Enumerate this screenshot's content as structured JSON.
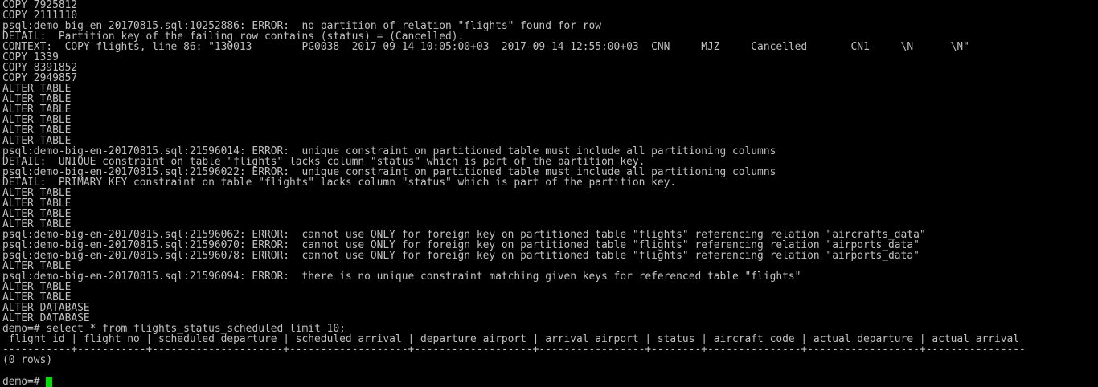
{
  "terminal": {
    "lines": [
      "COPY 7925812",
      "COPY 2111110",
      "psql:demo-big-en-20170815.sql:10252886: ERROR:  no partition of relation \"flights\" found for row",
      "DETAIL:  Partition key of the failing row contains (status) = (Cancelled).",
      "CONTEXT:  COPY flights, line 86: \"130013        PG0038  2017-09-14 10:05:00+03  2017-09-14 12:55:00+03  CNN     MJZ     Cancelled       CN1     \\N      \\N\"",
      "COPY 1339",
      "COPY 8391852",
      "COPY 2949857",
      "ALTER TABLE",
      "ALTER TABLE",
      "ALTER TABLE",
      "ALTER TABLE",
      "ALTER TABLE",
      "ALTER TABLE",
      "psql:demo-big-en-20170815.sql:21596014: ERROR:  unique constraint on partitioned table must include all partitioning columns",
      "DETAIL:  UNIQUE constraint on table \"flights\" lacks column \"status\" which is part of the partition key.",
      "psql:demo-big-en-20170815.sql:21596022: ERROR:  unique constraint on partitioned table must include all partitioning columns",
      "DETAIL:  PRIMARY KEY constraint on table \"flights\" lacks column \"status\" which is part of the partition key.",
      "ALTER TABLE",
      "ALTER TABLE",
      "ALTER TABLE",
      "ALTER TABLE",
      "psql:demo-big-en-20170815.sql:21596062: ERROR:  cannot use ONLY for foreign key on partitioned table \"flights\" referencing relation \"aircrafts_data\"",
      "psql:demo-big-en-20170815.sql:21596070: ERROR:  cannot use ONLY for foreign key on partitioned table \"flights\" referencing relation \"airports_data\"",
      "psql:demo-big-en-20170815.sql:21596078: ERROR:  cannot use ONLY for foreign key on partitioned table \"flights\" referencing relation \"airports_data\"",
      "ALTER TABLE",
      "psql:demo-big-en-20170815.sql:21596094: ERROR:  there is no unique constraint matching given keys for referenced table \"flights\"",
      "ALTER TABLE",
      "ALTER TABLE",
      "ALTER DATABASE",
      "ALTER DATABASE",
      "demo=# select * from flights_status_scheduled limit 10;",
      " flight_id | flight_no | scheduled_departure | scheduled_arrival | departure_airport | arrival_airport | status | aircraft_code | actual_departure | actual_arrival",
      "-----------+-----------+---------------------+-------------------+-------------------+-----------------+--------+---------------+------------------+----------------",
      "(0 rows)"
    ],
    "prompt": "demo=# ",
    "cursor_color": "#00e000",
    "text_color": "#c0c0c0",
    "background_color": "#000000"
  }
}
